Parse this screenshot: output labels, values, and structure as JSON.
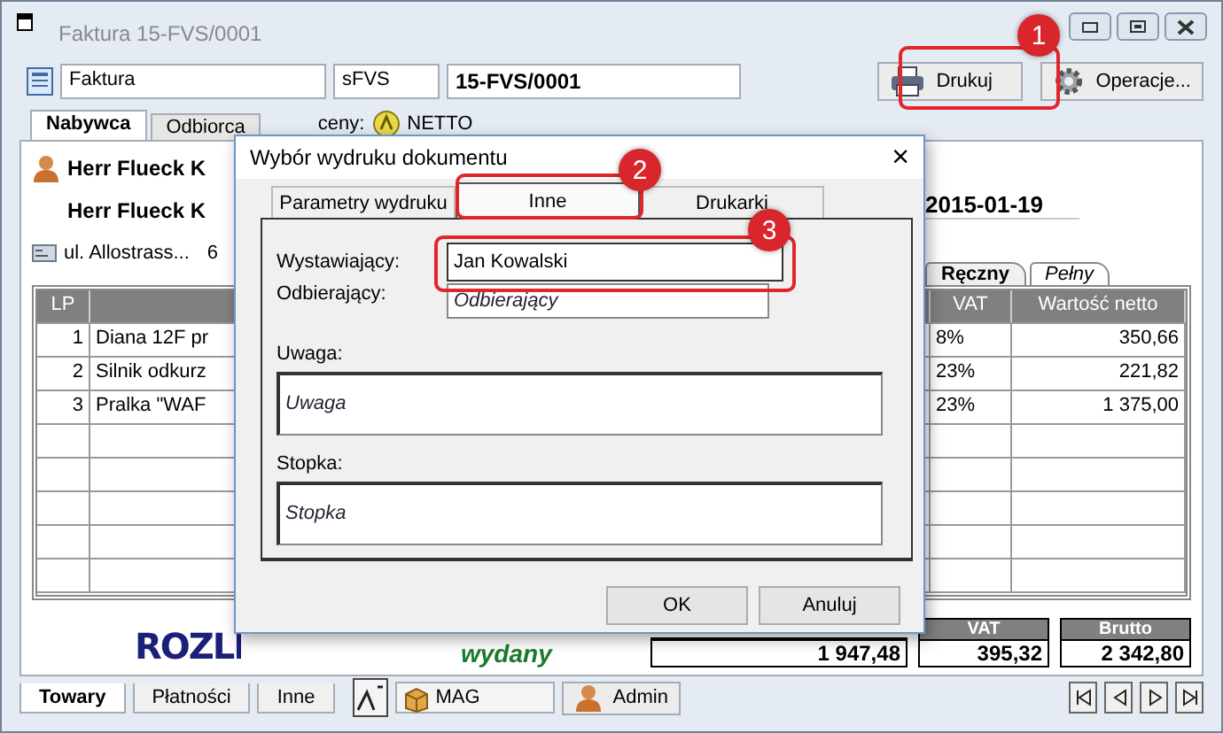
{
  "window": {
    "title": "Faktura 15-FVS/0001"
  },
  "toolbar": {
    "document_type": "Faktura",
    "series": "sFVS",
    "number": "15-FVS/0001",
    "buttons": [
      {
        "label": "Drukuj",
        "kind": "print"
      },
      {
        "label": "Operacje...",
        "kind": "operations"
      }
    ]
  },
  "main_tabs": [
    {
      "label": "Nabywca",
      "selected": true
    },
    {
      "label": "Odbiorca",
      "selected": false
    }
  ],
  "price_type": {
    "label": "ceny:",
    "value": "NETTO"
  },
  "buyer": {
    "name": "Herr Flueck K",
    "full_name": "Herr Flueck K",
    "address": "ul. Allostrass...",
    "address_2": "6"
  },
  "date": "2015-01-19",
  "mode_tabs": [
    {
      "label": "Ręczny",
      "selected": true
    },
    {
      "label": "Pełny",
      "selected": false
    }
  ],
  "table": {
    "columns": [
      "LP",
      "VAT",
      "Wartość netto"
    ],
    "rows": [
      {
        "lp": "1",
        "column_2": "Diana 12F pr",
        "vat": "8%",
        "wartosc_netto": "350,66"
      },
      {
        "lp": "2",
        "column_2": "Silnik odkurz",
        "vat": "23%",
        "wartosc_netto": "221,82"
      },
      {
        "lp": "3",
        "column_2": "Pralka \"WAF",
        "vat": "23%",
        "wartosc_netto": "1 375,00"
      }
    ]
  },
  "stamp": "ROZLI",
  "issue_status": "wydany",
  "totals": [
    {
      "value": "1 947,48"
    },
    {
      "label": "VAT",
      "value": "395,32"
    },
    {
      "label": "Brutto",
      "value": "2 342,80"
    }
  ],
  "bottom_tabs": [
    {
      "label": "Towary",
      "selected": true
    },
    {
      "label": "Płatności",
      "selected": false
    },
    {
      "label": "Inne",
      "selected": false
    }
  ],
  "warehouse": "MAG",
  "user": "Admin",
  "dialog": {
    "title": "Wybór wydruku dokumentu",
    "close": "×",
    "tabs": [
      {
        "label": "Parametry wydruku",
        "selected": false
      },
      {
        "label": "Inne",
        "selected": true
      },
      {
        "label": "Drukarki",
        "selected": false
      }
    ],
    "issuer": {
      "label": "Wystawiający:",
      "value": "Jan Kowalski"
    },
    "receiver": {
      "label": "Odbierający:",
      "placeholder": "Odbierający"
    },
    "note": {
      "label": "Uwaga:",
      "placeholder": "Uwaga"
    },
    "footer": {
      "label": "Stopka:",
      "placeholder": "Stopka"
    },
    "buttons": [
      "OK",
      "Anuluj"
    ]
  },
  "annotations": [
    {
      "label": "1"
    },
    {
      "label": "2"
    },
    {
      "label": "3"
    }
  ]
}
